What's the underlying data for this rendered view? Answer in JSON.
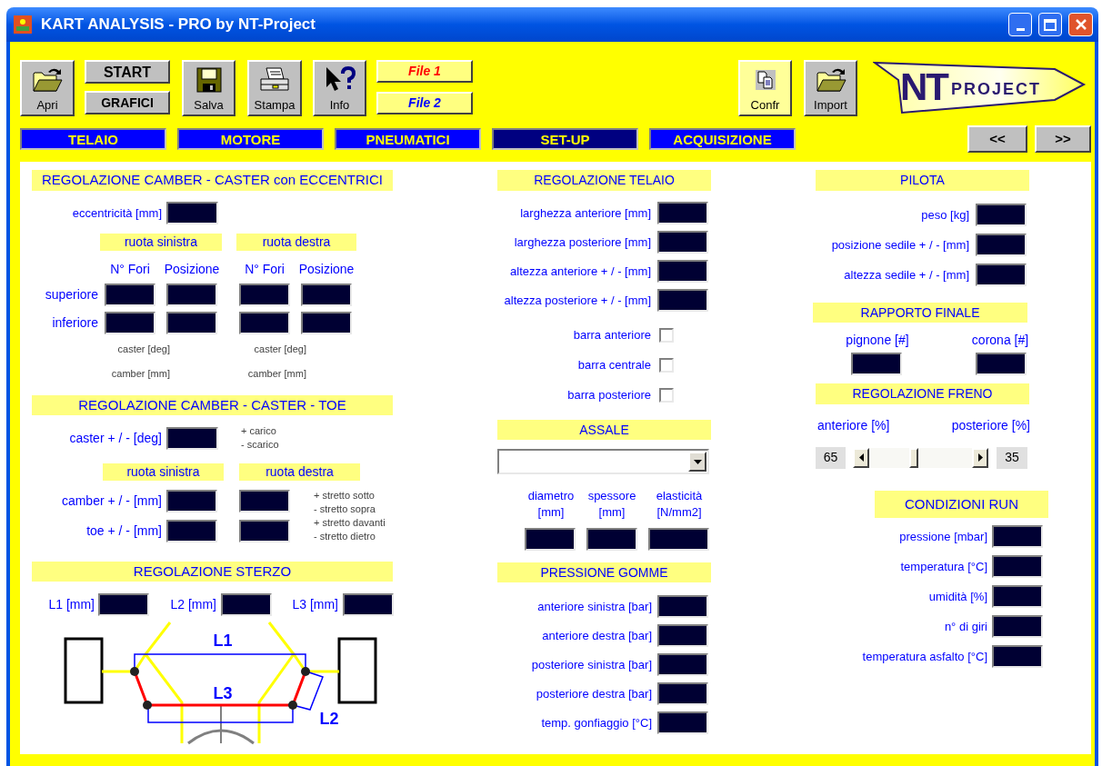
{
  "window": {
    "title": "KART ANALYSIS - PRO by NT-Project"
  },
  "toolbar": {
    "open": "Apri",
    "start": "START",
    "charts": "GRAFICI",
    "save": "Salva",
    "print": "Stampa",
    "info": "Info",
    "files": [
      {
        "label": "File 1",
        "kind": "reference"
      },
      {
        "label": "File 2",
        "kind": "comparison"
      }
    ],
    "compare": {
      "label": "Confr",
      "highlighted": true
    },
    "import": {
      "label": "Import",
      "highlighted": false
    }
  },
  "logo": {
    "initials": "NT",
    "word": "PROJECT"
  },
  "tabs": [
    {
      "label": "TELAIO",
      "selected": false
    },
    {
      "label": "MOTORE",
      "selected": false
    },
    {
      "label": "PNEUMATICI",
      "selected": false
    },
    {
      "label": "SET-UP",
      "selected": true
    },
    {
      "label": "ACQUISIZIONE",
      "selected": false
    }
  ],
  "nav_buttons": [
    "<<",
    ">>"
  ],
  "eccentric_camber_caster": {
    "title": "REGOLAZIONE CAMBER - CASTER con ECCENTRICI",
    "eccentricity_label": "eccentricità [mm]",
    "wheels": [
      "ruota sinistra",
      "ruota destra"
    ],
    "column_headers": [
      "N° Fori",
      "Posizione",
      "N° Fori",
      "Posizione"
    ],
    "rows": [
      "superiore",
      "inferiore"
    ],
    "notes": [
      [
        "caster [deg]",
        "camber [mm]"
      ],
      [
        "caster [deg]",
        "camber [mm]"
      ]
    ]
  },
  "camber_caster_toe": {
    "title": "REGOLAZIONE CAMBER - CASTER - TOE",
    "caster_label": "caster + / -  [deg]",
    "caster_notes": [
      "+ carico",
      "- scarico"
    ],
    "wheels": [
      "ruota sinistra",
      "ruota destra"
    ],
    "rows": [
      "camber + / -  [mm]",
      "toe + / -  [mm]"
    ],
    "notes": [
      "+ stretto sotto",
      "- stretto sopra",
      "+ stretto davanti",
      "- stretto dietro"
    ]
  },
  "steering": {
    "title": "REGOLAZIONE STERZO",
    "fields": [
      "L1 [mm]",
      "L2 [mm]",
      "L3 [mm]"
    ],
    "diagram_labels": [
      "L1",
      "L3",
      "L2"
    ]
  },
  "frame": {
    "title": "REGOLAZIONE TELAIO",
    "fields": [
      "larghezza anteriore [mm]",
      "larghezza posteriore [mm]",
      "altezza anteriore + / -  [mm]",
      "altezza posteriore + / -  [mm]"
    ],
    "bars": [
      {
        "label": "barra anteriore",
        "checked": false
      },
      {
        "label": "barra centrale",
        "checked": false
      },
      {
        "label": "barra posteriore",
        "checked": false
      }
    ]
  },
  "axle": {
    "title": "ASSALE",
    "columns": [
      [
        "diametro",
        "[mm]"
      ],
      [
        "spessore",
        "[mm]"
      ],
      [
        "elasticità",
        "[N/mm2]"
      ]
    ]
  },
  "tyre_pressure": {
    "title": "PRESSIONE GOMME",
    "fields": [
      "anteriore sinistra [bar]",
      "anteriore destra [bar]",
      "posteriore sinistra [bar]",
      "posteriore destra [bar]",
      "temp. gonfiaggio [°C]"
    ]
  },
  "driver": {
    "title": "PILOTA",
    "fields": [
      "peso [kg]",
      "posizione sedile + / -  [mm]",
      "altezza sedile + / - [mm]"
    ]
  },
  "final_drive": {
    "title": "RAPPORTO FINALE",
    "fields": [
      "pignone [#]",
      "corona [#]"
    ]
  },
  "brake": {
    "title": "REGOLAZIONE FRENO",
    "front_label": "anteriore [%]",
    "rear_label": "posteriore [%]",
    "front_value": "65",
    "rear_value": "35",
    "level": 0.43
  },
  "run_conditions": {
    "title": "CONDIZIONI RUN",
    "fields": [
      "pressione [mbar]",
      "temperatura [°C]",
      "umidità [%]",
      "n° di giri",
      "temperatura asfalto [°C]"
    ]
  }
}
